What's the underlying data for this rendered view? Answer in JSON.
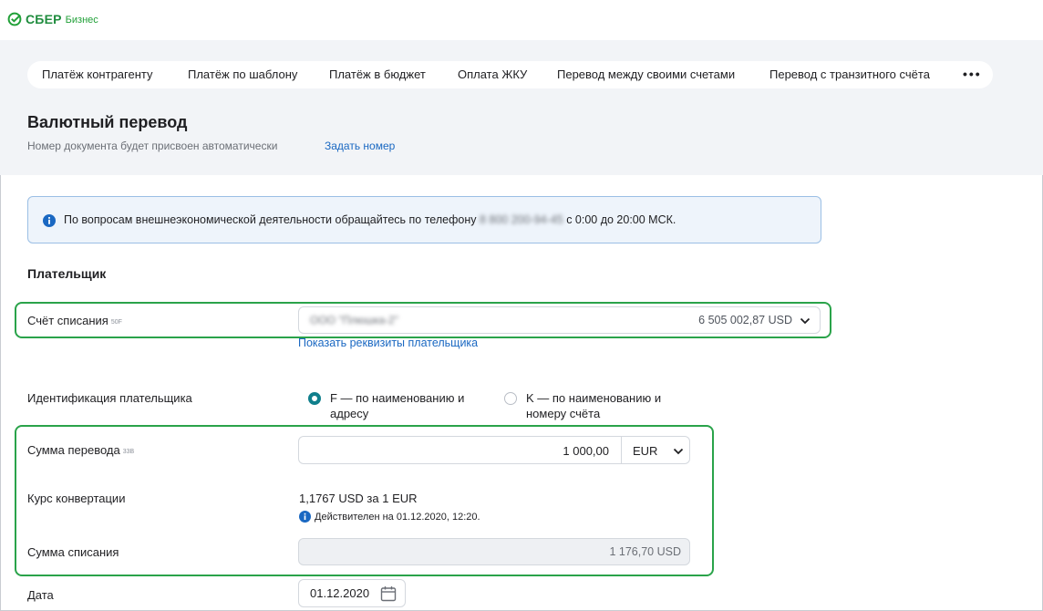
{
  "brand": {
    "name": "СБЕР",
    "sub": "Бизнес",
    "color": "#21a038"
  },
  "tabs": [
    {
      "label": "Платёж контрагенту"
    },
    {
      "label": "Платёж по шаблону"
    },
    {
      "label": "Платёж в бюджет"
    },
    {
      "label": "Оплата ЖКУ"
    },
    {
      "label": "Перевод между своими счетами"
    },
    {
      "label": "Перевод с транзитного счёта"
    }
  ],
  "more_label": "•••",
  "page": {
    "title": "Валютный перевод",
    "subtitle": "Номер документа будет присвоен автоматически",
    "set_number_link": "Задать номер"
  },
  "info": {
    "text_before": "По вопросам внешнеэкономической деятельности обращайтесь по телефону",
    "phone": "8 800 200-94-45",
    "text_after": "с 0:00 до 20:00 МСК."
  },
  "payer": {
    "section_title": "Плательщик",
    "account_label": "Счёт списания",
    "account_tag": "50F",
    "account_name": "ООО \"Плюшка-2\"",
    "account_balance": "6 505 002,87 USD",
    "show_details_link": "Показать реквизиты плательщика",
    "identification_label": "Идентификация плательщика",
    "options": [
      {
        "label": "F — по наименованию и адресу",
        "selected": true
      },
      {
        "label": "K — по наименованию и номеру счёта",
        "selected": false
      }
    ]
  },
  "transfer": {
    "amount_label": "Сумма перевода",
    "amount_tag": "33B",
    "amount_value": "1 000,00",
    "currency": "EUR",
    "rate_label": "Курс конвертации",
    "rate_value": "1,1767 USD за 1 EUR",
    "rate_note": "Действителен на 01.12.2020, 12:20.",
    "debit_label": "Сумма списания",
    "debit_value": "1 176,70  USD"
  },
  "date": {
    "label": "Дата",
    "value": "01.12.2020"
  },
  "colors": {
    "accent": "#107f8c",
    "link": "#1a68c2",
    "highlight": "#2aa34a",
    "info_bg": "#eef4fb"
  }
}
